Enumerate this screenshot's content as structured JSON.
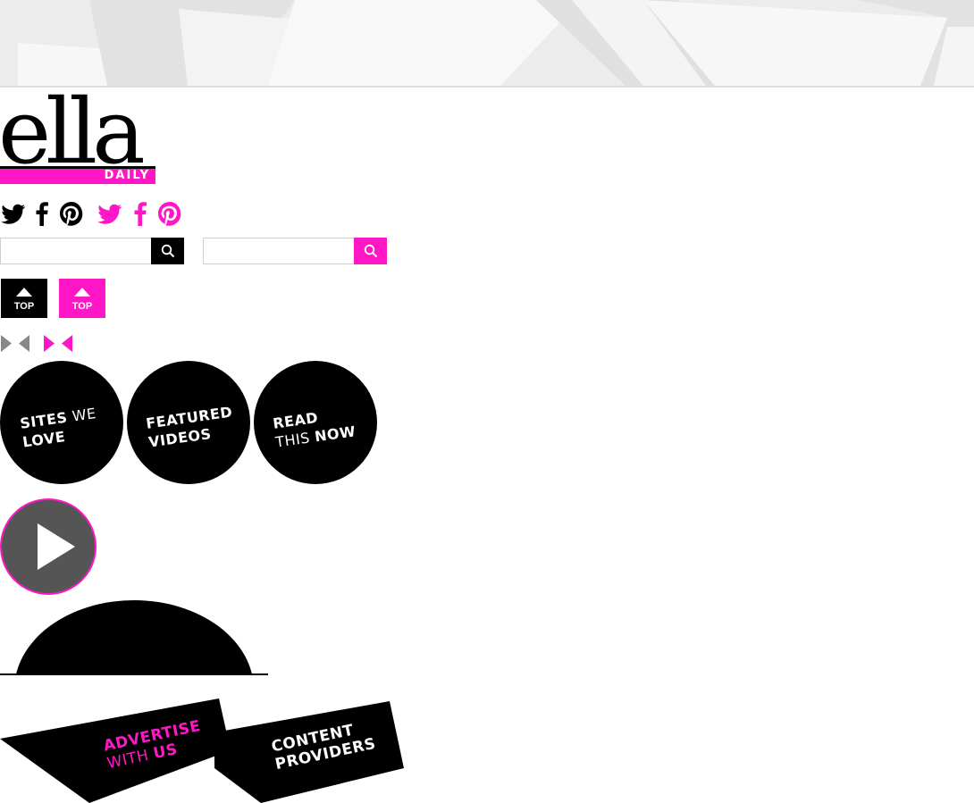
{
  "logo": {
    "word": "ella",
    "sub": "DAILY",
    "brand_color": "#ff17c7"
  },
  "social": {
    "icons": [
      {
        "name": "twitter-icon",
        "color": "#000000"
      },
      {
        "name": "facebook-icon",
        "color": "#000000"
      },
      {
        "name": "pinterest-icon",
        "color": "#000000"
      },
      {
        "name": "twitter-icon",
        "color": "#ff17c7"
      },
      {
        "name": "facebook-icon",
        "color": "#ff17c7"
      },
      {
        "name": "pinterest-icon",
        "color": "#ff17c7"
      }
    ]
  },
  "search": {
    "placeholder": "",
    "value": ""
  },
  "top_buttons": [
    {
      "label": "TOP",
      "color": "#000000"
    },
    {
      "label": "TOP",
      "color": "#ff17c7"
    }
  ],
  "circles": {
    "sites": {
      "bold": "SITES",
      "light": "WE",
      "line2": "LOVE"
    },
    "featured": {
      "line1": "FEATURED",
      "line2": "VIDEOS"
    },
    "read": {
      "line1": "READ",
      "light": "THIS",
      "bold": "NOW"
    }
  },
  "ribbons": {
    "advertise": {
      "line1": "ADVERTISE",
      "light": "WITH",
      "bold": "US"
    },
    "content": {
      "line1": "CONTENT",
      "line2": "PROVIDERS"
    }
  }
}
